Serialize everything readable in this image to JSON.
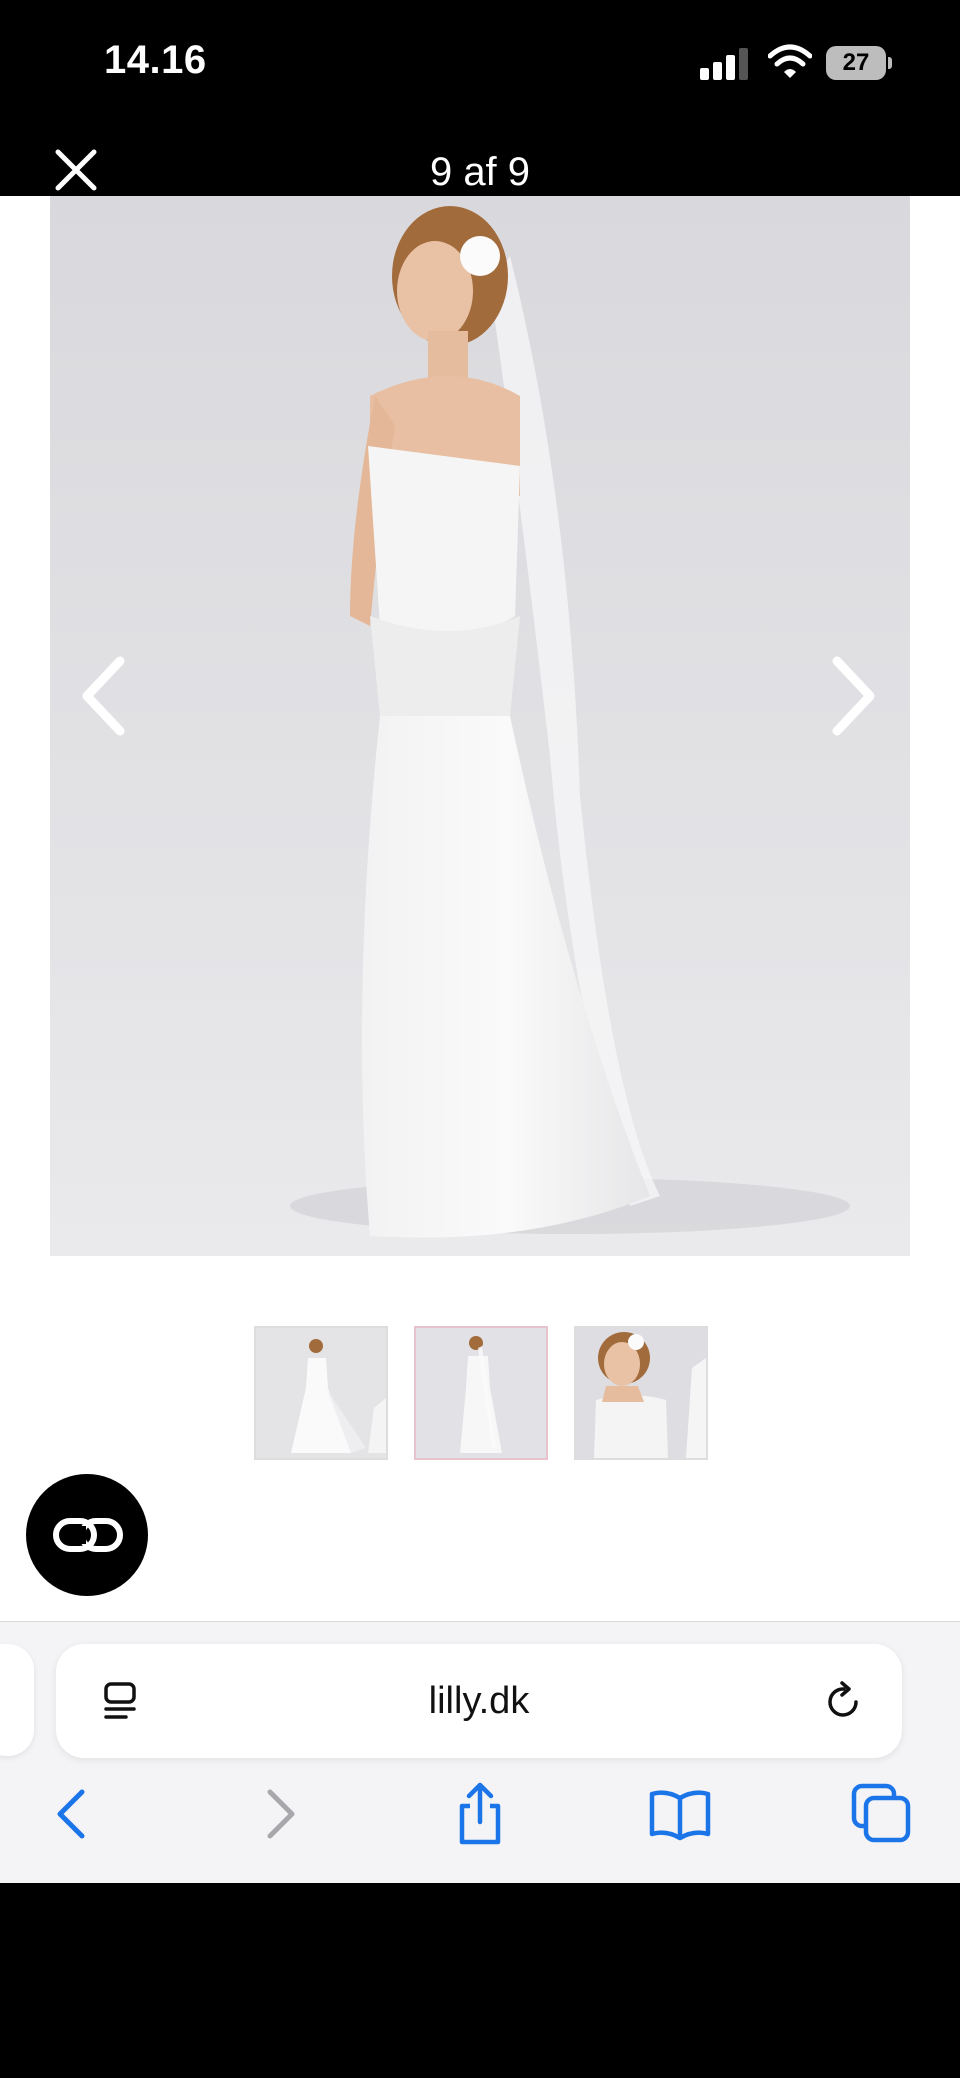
{
  "status_bar": {
    "time": "14.16",
    "battery_level": "27"
  },
  "viewer": {
    "counter": "9 af 9"
  },
  "gallery": {
    "thumbnail_count": 3,
    "active_thumbnail": 2
  },
  "browser": {
    "url": "lilly.dk"
  },
  "icons": {
    "close": "close-icon",
    "prev": "chevron-left-icon",
    "next": "chevron-right-icon",
    "fab": "link-icon",
    "reader": "reader-icon",
    "reload": "reload-icon",
    "back": "back-icon",
    "forward": "forward-icon",
    "share": "share-icon",
    "bookmarks": "bookmarks-icon",
    "tabs": "tabs-icon"
  },
  "colors": {
    "accent": "#1c74e9",
    "disabled": "#a8a8ac"
  }
}
